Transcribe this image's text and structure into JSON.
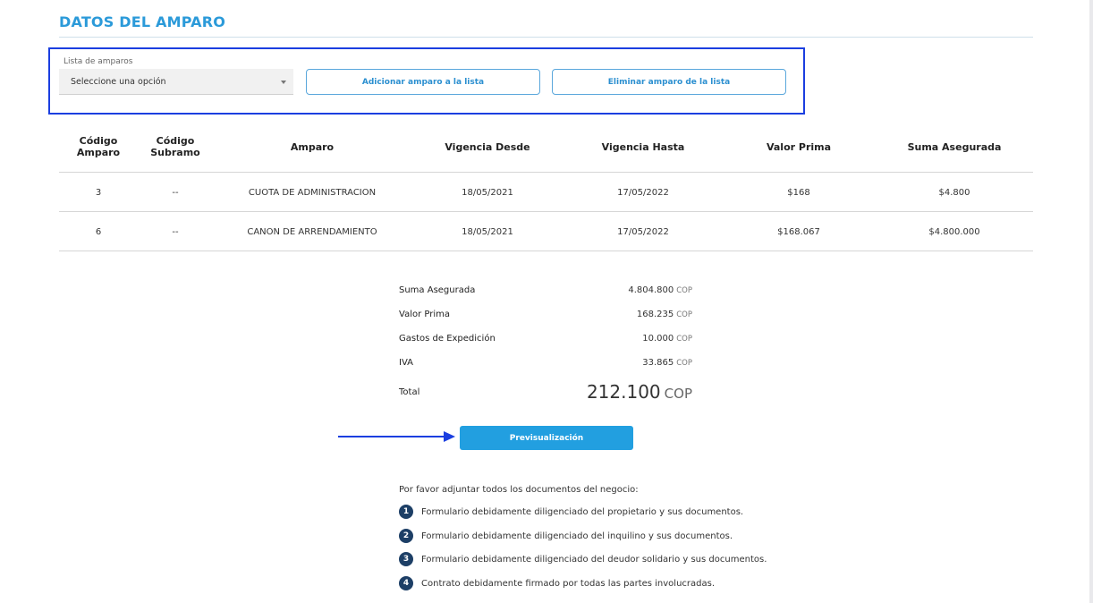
{
  "section": {
    "title": "DATOS DEL AMPARO"
  },
  "amparos": {
    "label": "Lista de amparos",
    "selected": "Seleccione una opción",
    "add_label": "Adicionar amparo a la lista",
    "remove_label": "Eliminar amparo de la lista"
  },
  "table": {
    "headers": [
      "Código Amparo",
      "Código Subramo",
      "Amparo",
      "Vigencia Desde",
      "Vigencia Hasta",
      "Valor Prima",
      "Suma Asegurada"
    ],
    "rows": [
      [
        "3",
        "--",
        "CUOTA DE ADMINISTRACION",
        "18/05/2021",
        "17/05/2022",
        "$168",
        "$4.800"
      ],
      [
        "6",
        "--",
        "CANON DE ARRENDAMIENTO",
        "18/05/2021",
        "17/05/2022",
        "$168.067",
        "$4.800.000"
      ]
    ]
  },
  "summary": {
    "items": [
      {
        "label": "Suma Asegurada",
        "value": "4.804.800",
        "currency": "COP"
      },
      {
        "label": "Valor Prima",
        "value": "168.235",
        "currency": "COP"
      },
      {
        "label": "Gastos de Expedición",
        "value": "10.000",
        "currency": "COP"
      },
      {
        "label": "IVA",
        "value": "33.865",
        "currency": "COP"
      }
    ],
    "total_label": "Total",
    "total_value": "212.100",
    "total_currency": "COP"
  },
  "preview_label": "Previsualización",
  "documents": {
    "intro": "Por favor adjuntar todos los documentos del negocio:",
    "items": [
      {
        "num": "1",
        "text": "Formulario debidamente diligenciado del propietario y sus documentos."
      },
      {
        "num": "2",
        "text": "Formulario debidamente diligenciado del inquilino y sus documentos."
      },
      {
        "num": "3",
        "text": "Formulario debidamente diligenciado del deudor solidario y sus documentos."
      },
      {
        "num": "4",
        "text": "Contrato debidamente firmado por todas las partes involucradas."
      }
    ]
  },
  "colors": {
    "title": "#2b9ad9",
    "primary": "#229fe0",
    "highlight": "#1b3fe0",
    "step_badge": "#1d3f66"
  },
  "icons": {
    "annotation_arrow": "arrow-right-icon",
    "select_caret": "caret-down-icon"
  }
}
